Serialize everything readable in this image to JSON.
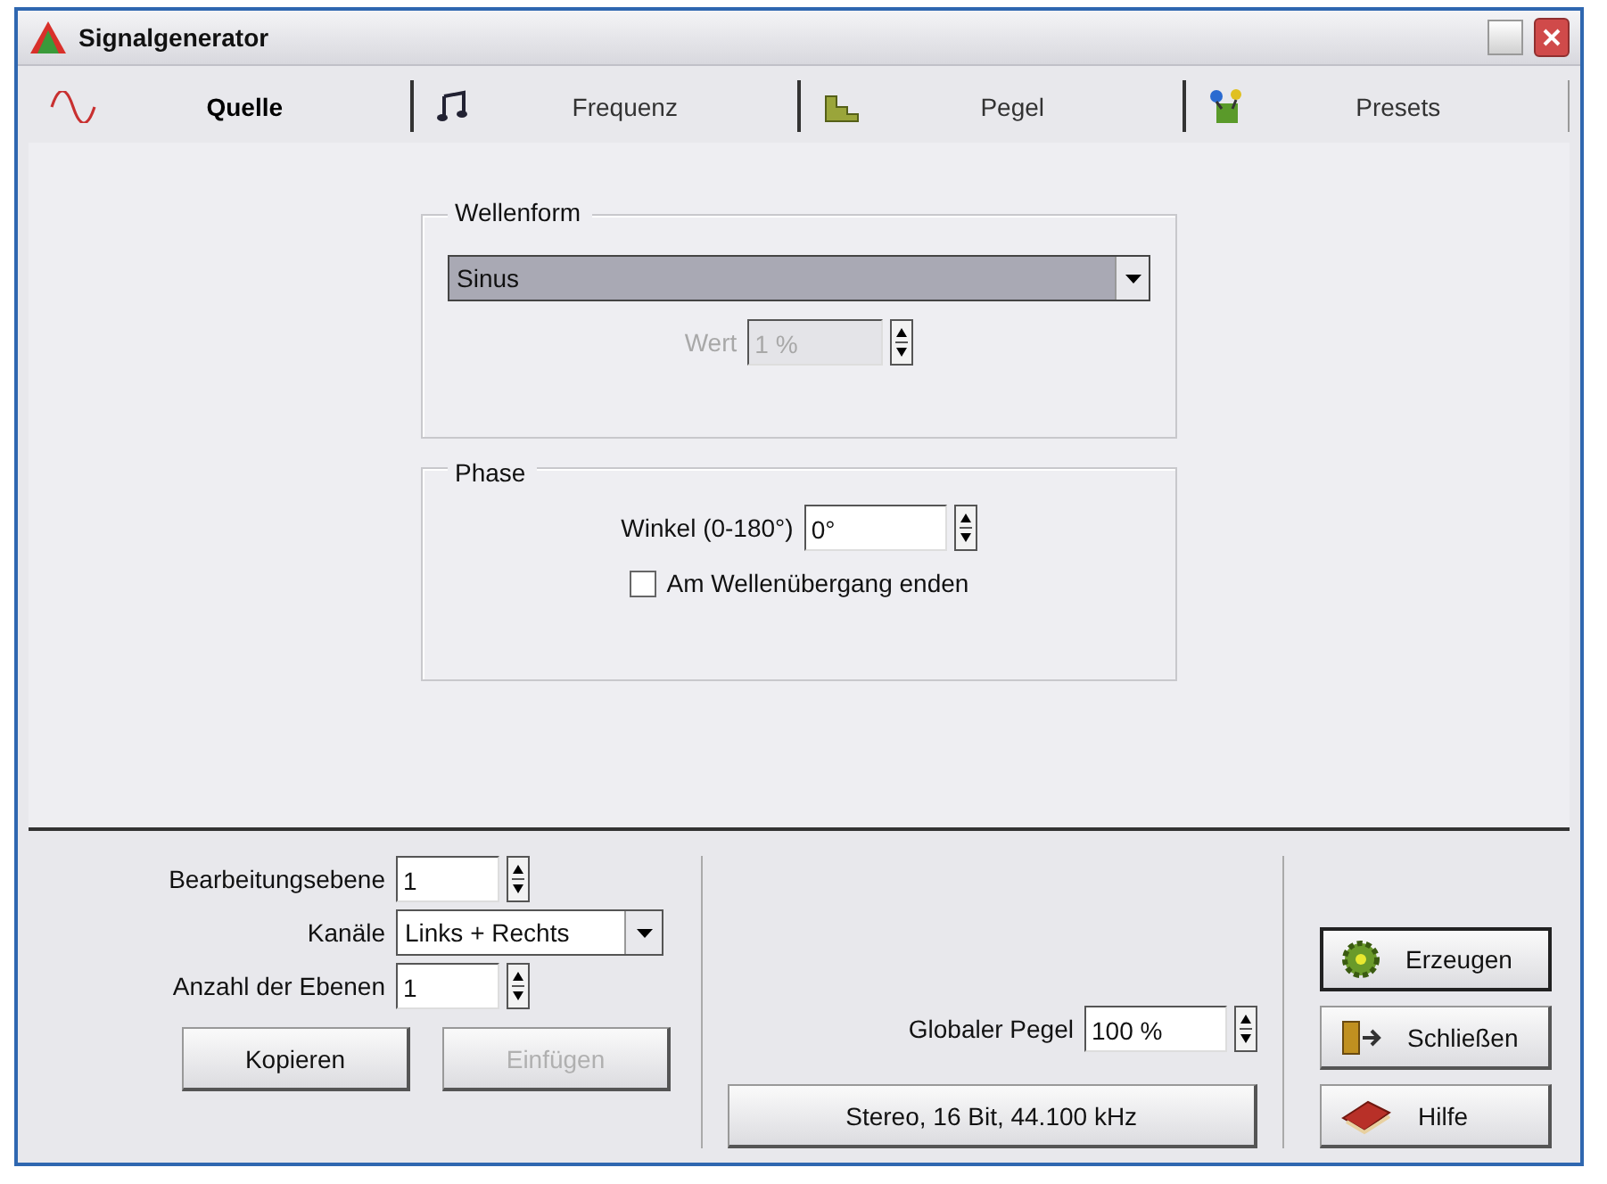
{
  "window": {
    "title": "Signalgenerator"
  },
  "tabs": [
    {
      "label": "Quelle",
      "kind": "sine",
      "selected": true
    },
    {
      "label": "Frequenz",
      "kind": "notes",
      "selected": false
    },
    {
      "label": "Pegel",
      "kind": "level",
      "selected": false
    },
    {
      "label": "Presets",
      "kind": "presets",
      "selected": false
    }
  ],
  "waveform": {
    "title": "Wellenform",
    "value": "Sinus",
    "value_label": "Wert",
    "value_field": "1 %",
    "value_disabled": true
  },
  "phase": {
    "title": "Phase",
    "angle_label": "Winkel (0-180°)",
    "angle": "0°",
    "checkbox": {
      "label": "Am Wellenübergang enden",
      "checked": false
    }
  },
  "layers": {
    "fields": [
      {
        "kind": "spin",
        "label": "Bearbeitungsebene",
        "value": "1"
      },
      {
        "kind": "select",
        "label": "Kanäle",
        "value": "Links + Rechts"
      },
      {
        "kind": "spin",
        "label": "Anzahl der Ebenen",
        "value": "1"
      }
    ],
    "buttons": [
      {
        "label": "Kopieren",
        "disabled": false
      },
      {
        "label": "Einfügen",
        "disabled": true
      }
    ]
  },
  "output": {
    "level_label": "Globaler Pegel",
    "level_value": "100 %",
    "format_button": "Stereo, 16 Bit, 44.100 kHz"
  },
  "actions": [
    {
      "label": "Erzeugen",
      "kind": "generate",
      "default": true
    },
    {
      "label": "Schließen",
      "kind": "close",
      "default": false
    },
    {
      "label": "Hilfe",
      "kind": "help",
      "default": false
    }
  ]
}
